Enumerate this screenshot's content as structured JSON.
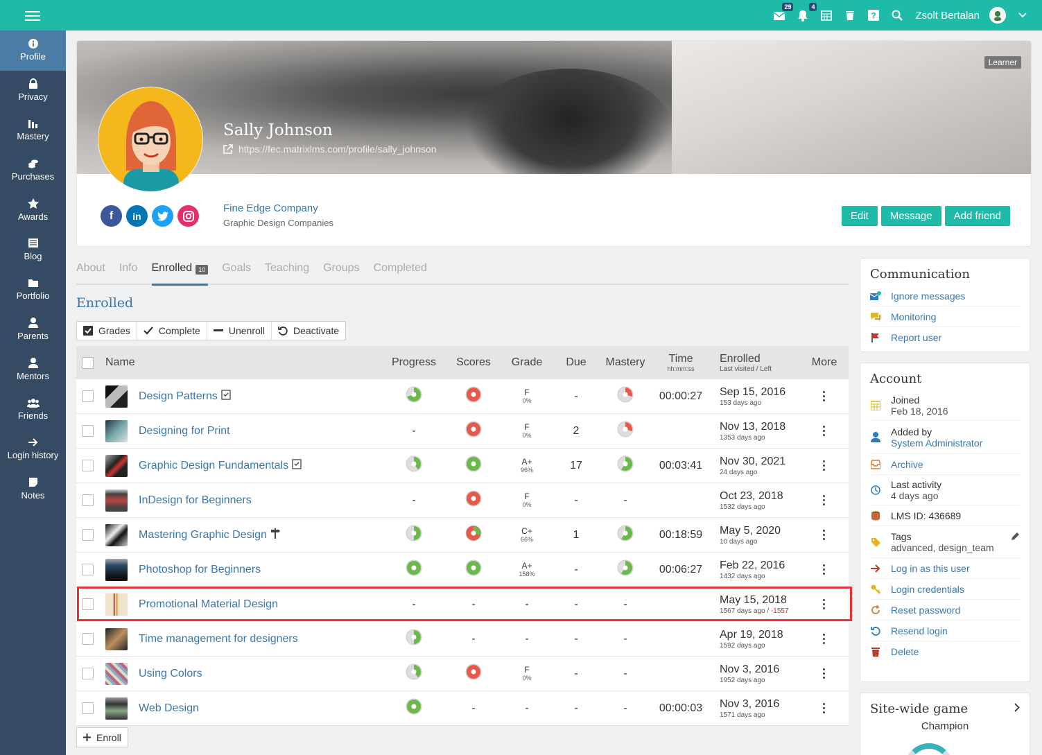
{
  "topbar": {
    "notifications": [
      {
        "icon": "envelope-check-icon",
        "count": "29"
      },
      {
        "icon": "bell-icon",
        "count": "4"
      }
    ],
    "user_name": "Zsolt Bertalan"
  },
  "sidebar": {
    "items": [
      {
        "label": "Profile",
        "icon": "info-icon",
        "active": true
      },
      {
        "label": "Privacy",
        "icon": "lock-icon"
      },
      {
        "label": "Mastery",
        "icon": "bar-chart-icon"
      },
      {
        "label": "Purchases",
        "icon": "coins-icon"
      },
      {
        "label": "Awards",
        "icon": "star-icon"
      },
      {
        "label": "Blog",
        "icon": "newspaper-icon"
      },
      {
        "label": "Portfolio",
        "icon": "folder-icon"
      },
      {
        "label": "Parents",
        "icon": "user-icon"
      },
      {
        "label": "Mentors",
        "icon": "user-icon"
      },
      {
        "label": "Friends",
        "icon": "users-icon"
      },
      {
        "label": "Login history",
        "icon": "arrow-right-icon"
      },
      {
        "label": "Notes",
        "icon": "note-icon"
      }
    ]
  },
  "profile": {
    "role_badge": "Learner",
    "name": "Sally Johnson",
    "url": "https://fec.matrixlms.com/profile/sally_johnson",
    "company": "Fine Edge Company",
    "company_sub": "Graphic Design Companies",
    "buttons": {
      "edit": "Edit",
      "message": "Message",
      "add_friend": "Add friend"
    },
    "social_colors": {
      "facebook": "#3b5998",
      "linkedin": "#0077b5",
      "twitter": "#1da1f2",
      "instagram": "#e1306c"
    }
  },
  "tabs": [
    {
      "label": "About"
    },
    {
      "label": "Info"
    },
    {
      "label": "Enrolled",
      "badge": "10",
      "active": true
    },
    {
      "label": "Goals"
    },
    {
      "label": "Teaching"
    },
    {
      "label": "Groups"
    },
    {
      "label": "Completed"
    }
  ],
  "section_title": "Enrolled",
  "actions": {
    "grades": "Grades",
    "complete": "Complete",
    "unenroll": "Unenroll",
    "deactivate": "Deactivate"
  },
  "table": {
    "headers": {
      "name": "Name",
      "progress": "Progress",
      "scores": "Scores",
      "grade": "Grade",
      "due": "Due",
      "mastery": "Mastery",
      "time": "Time",
      "time_sub": "hh:mm:ss",
      "enrolled": "Enrolled",
      "enrolled_sub": "Last visited / Left",
      "more": "More"
    },
    "rows": [
      {
        "name": "Design Patterns",
        "tag": "check",
        "thumb": "#2a2a2a",
        "progress": 0.7,
        "score": "red",
        "grade": "F",
        "grade_pct": "0%",
        "due": "-",
        "mastery": 0.3,
        "mastery_color": "red",
        "time": "00:00:27",
        "enrolled": "Sep 15, 2016",
        "last": "153 days ago"
      },
      {
        "name": "Designing for Print",
        "tag": "",
        "thumb": "#5a7aa0",
        "progress": null,
        "score": "red",
        "grade": "F",
        "grade_pct": "0%",
        "due": "2",
        "mastery": 0.3,
        "mastery_color": "red",
        "time": "",
        "enrolled": "Nov 13, 2018",
        "last": "1353 days ago"
      },
      {
        "name": "Graphic Design Fundamentals",
        "tag": "check",
        "thumb": "#333",
        "progress": 0.4,
        "score": "green",
        "grade": "A+",
        "grade_pct": "96%",
        "due": "17",
        "mastery": 0.6,
        "mastery_color": "green",
        "time": "00:03:41",
        "enrolled": "Nov 30, 2021",
        "last": "24 days ago"
      },
      {
        "name": "InDesign for Beginners",
        "tag": "",
        "thumb": "#666",
        "progress": null,
        "score": "red",
        "grade": "F",
        "grade_pct": "0%",
        "due": "-",
        "mastery": null,
        "time": "",
        "enrolled": "Oct 23, 2018",
        "last": "1532 days ago"
      },
      {
        "name": "Mastering Graphic Design",
        "tag": "sign",
        "thumb": "#222",
        "progress": 0.5,
        "score": "redgreen",
        "grade": "C+",
        "grade_pct": "66%",
        "due": "1",
        "mastery": 0.6,
        "mastery_color": "green",
        "time": "00:18:59",
        "enrolled": "May 5, 2020",
        "last": "10 days ago"
      },
      {
        "name": "Photoshop for Beginners",
        "tag": "",
        "thumb": "#444",
        "progress": 1.0,
        "score": "green",
        "grade": "A+",
        "grade_pct": "158%",
        "due": "-",
        "mastery": 0.6,
        "mastery_color": "green",
        "time": "00:06:27",
        "enrolled": "Feb 22, 2016",
        "last": "1432 days ago"
      },
      {
        "name": "Promotional Material Design",
        "tag": "",
        "thumb": "#e0d4b8",
        "progress": null,
        "score": "-",
        "grade": "-",
        "grade_pct": "",
        "due": "-",
        "mastery": null,
        "time": "",
        "enrolled": "May 15, 2018",
        "last": "1567 days ago / ",
        "left": "-1557"
      },
      {
        "name": "Time management for designers",
        "tag": "",
        "thumb": "#3a2e25",
        "progress": 0.5,
        "score": "-",
        "grade": "-",
        "grade_pct": "",
        "due": "-",
        "mastery": null,
        "time": "",
        "enrolled": "Apr 19, 2018",
        "last": "1592 days ago"
      },
      {
        "name": "Using Colors",
        "tag": "",
        "thumb": "#8a6a80",
        "progress": 0.4,
        "score": "red",
        "grade": "F",
        "grade_pct": "0%",
        "due": "-",
        "mastery": null,
        "time": "",
        "enrolled": "Nov 3, 2016",
        "last": "1952 days ago"
      },
      {
        "name": "Web Design",
        "tag": "",
        "thumb": "#555",
        "progress": 1.0,
        "score": "-",
        "grade": "-",
        "grade_pct": "",
        "due": "-",
        "mastery": null,
        "time": "00:00:03",
        "enrolled": "Nov 3, 2016",
        "last": "1571 days ago"
      }
    ]
  },
  "enroll_button": "Enroll",
  "communication": {
    "title": "Communication",
    "items": [
      {
        "label": "Ignore messages",
        "icon": "envelope-block-icon"
      },
      {
        "label": "Monitoring",
        "icon": "chat-icon"
      },
      {
        "label": "Report user",
        "icon": "flag-icon"
      }
    ]
  },
  "account": {
    "title": "Account",
    "joined_label": "Joined",
    "joined": "Feb 18, 2016",
    "added_label": "Added by",
    "added_by": "System Administrator",
    "archive": "Archive",
    "last_activity_label": "Last activity",
    "last_activity": "4 days ago",
    "lms_id": "LMS ID: 436689",
    "tags_label": "Tags",
    "tags": "advanced, design_team",
    "login_as": "Log in as this user",
    "login_credentials": "Login credentials",
    "reset_password": "Reset password",
    "resend_login": "Resend login",
    "delete": "Delete"
  },
  "game": {
    "title": "Site-wide game",
    "subtitle": "Champion"
  }
}
